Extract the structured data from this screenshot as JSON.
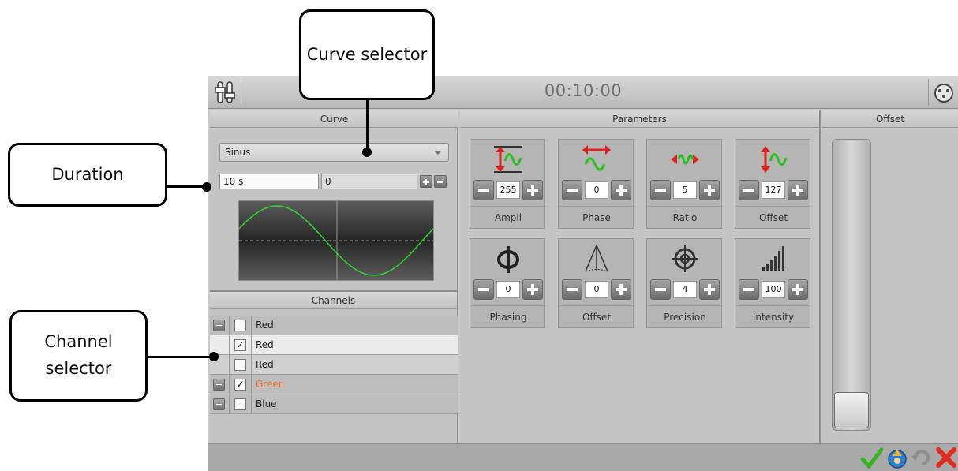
{
  "window": {
    "timer": "00:10:00"
  },
  "curve": {
    "title": "Curve",
    "selected_curve": "Sinus",
    "duration": "10 s",
    "second_value": "0"
  },
  "parameters": {
    "title": "Parameters",
    "tiles": [
      {
        "label": "Ampli",
        "value": "255",
        "icon": "amplitude-icon"
      },
      {
        "label": "Phase",
        "value": "0",
        "icon": "phase-icon"
      },
      {
        "label": "Ratio",
        "value": "5",
        "icon": "ratio-icon"
      },
      {
        "label": "Offset",
        "value": "127",
        "icon": "offset-icon"
      },
      {
        "label": "Phasing",
        "value": "0",
        "icon": "phi-icon"
      },
      {
        "label": "Offset",
        "value": "0",
        "icon": "spread-icon"
      },
      {
        "label": "Precision",
        "value": "4",
        "icon": "target-icon"
      },
      {
        "label": "Intensity",
        "value": "100",
        "icon": "signal-bars-icon"
      }
    ]
  },
  "offset": {
    "title": "Offset",
    "level": 0
  },
  "channels": {
    "title": "Channels",
    "rows": [
      {
        "name": "Red",
        "checked": false,
        "expander": "minus"
      },
      {
        "name": "Red",
        "checked": true,
        "expander": ""
      },
      {
        "name": "Red",
        "checked": false,
        "expander": ""
      },
      {
        "name": "Green",
        "checked": true,
        "expander": "plus"
      },
      {
        "name": "Blue",
        "checked": false,
        "expander": "plus"
      }
    ]
  },
  "callouts": {
    "curve_selector": "Curve selector",
    "duration": "Duration",
    "channel_selector": "Channel selector"
  },
  "colors": {
    "green_channel": "#f07030",
    "curve_line": "#2fd62f",
    "red_icon": "#e0201c",
    "green_icon": "#27c11f"
  }
}
